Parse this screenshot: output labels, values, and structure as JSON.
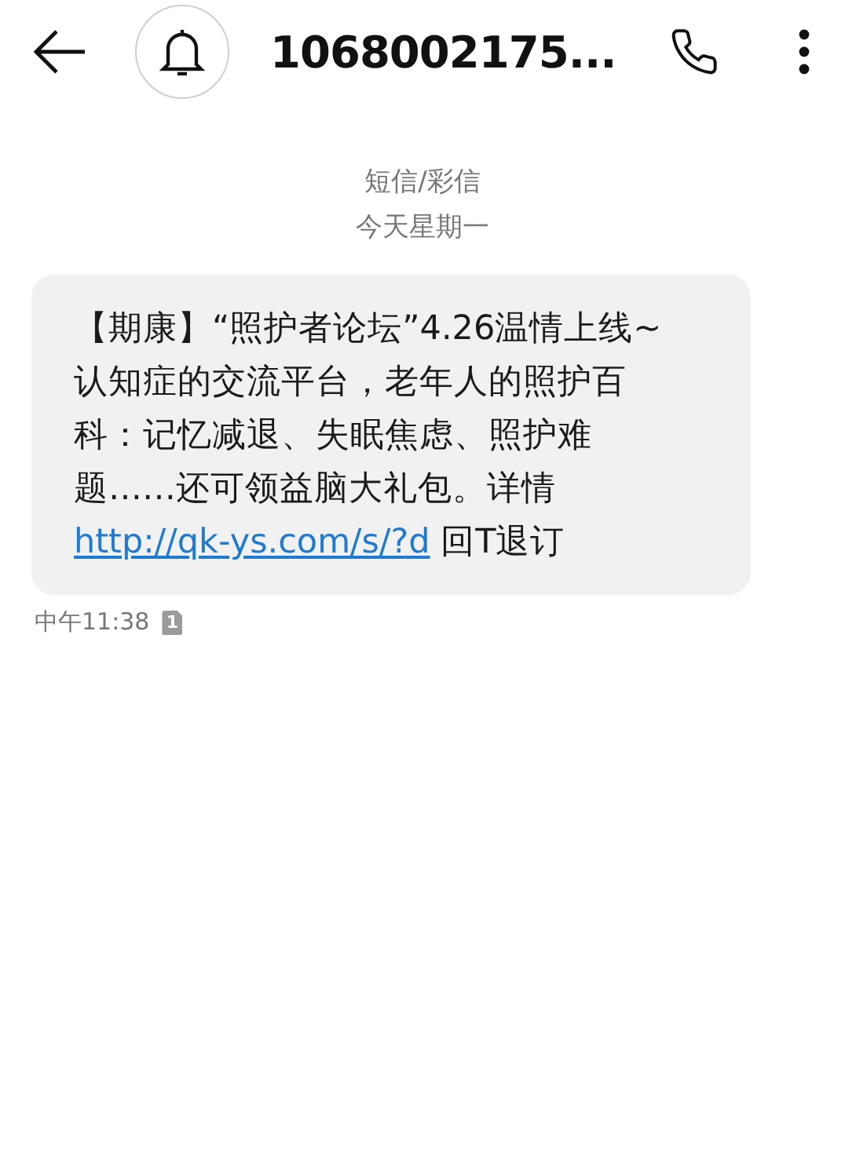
{
  "header": {
    "title": "1068002175..."
  },
  "conversation": {
    "channel": "短信/彩信",
    "date": "今天星期一"
  },
  "messages": [
    {
      "text": "【期康】“照护者论坛”4.26温情上线~认知症的交流平台，老年人的照护百科：记忆减退、失眠焦虑、照护难题……还可领益脑大礼包。详情",
      "link": "http://qk-ys.com/s/?d",
      "suffix": " 回T退订",
      "time": "中午11:38",
      "sim": "1"
    }
  ]
}
